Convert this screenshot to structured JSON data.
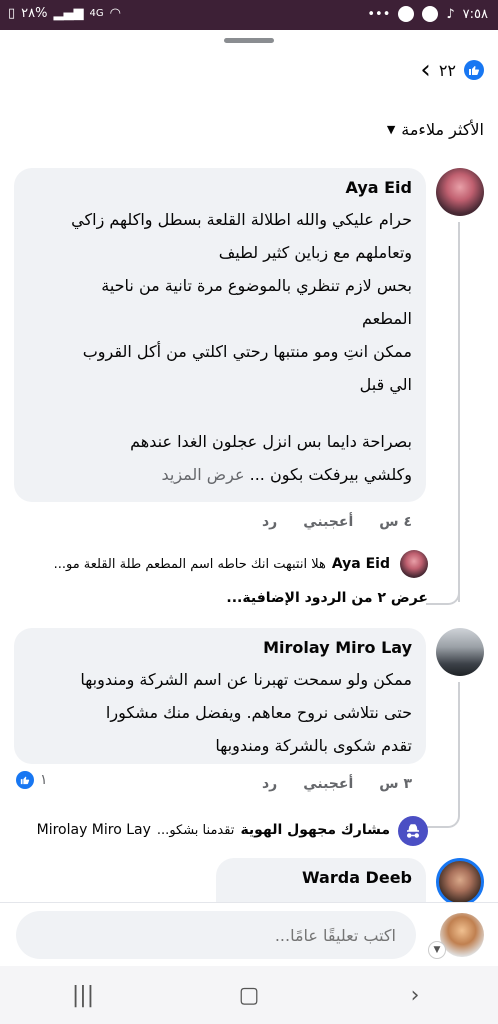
{
  "status_bar": {
    "time": "٧:٥٨",
    "battery": "٢٨%",
    "network": "4G"
  },
  "reactions": {
    "count": "٢٢"
  },
  "sort": {
    "label": "الأكثر ملاءمة"
  },
  "comments": [
    {
      "author": "Aya Eid",
      "lines": [
        "حرام عليكي والله اطلالة القلعة بسطل واكلهم زاكي",
        "وتعاملهم مع زباين كثير لطيف",
        "بحس لازم تنظري بالموضوع مرة تانية من ناحية",
        "المطعم",
        "ممكن انتِ ومو منتبها رحتي اكلتي من أكل القروب",
        "الي قبل",
        "",
        "بصراحة دايما بس انزل عجلون الغدا عندهم"
      ],
      "last_line": "وكلشي بيرفكت بكون ...",
      "see_more": "عرض المزيد",
      "time": "٤ س",
      "like_label": "أعجبني",
      "reply_label": "رد",
      "reply": {
        "author": "Aya Eid",
        "text": "هلا انتبهت انك حاطه اسم المطعم طلة القلعة مو..."
      },
      "more_replies": "عرض ٢ من الردود الإضافية..."
    },
    {
      "author": "Mirolay Miro Lay",
      "lines": [
        "ممكن ولو سمحت تهبرنا عن اسم الشركة ومندوبها",
        "حتى نتلاشى نروح معاهم. ويفضل منك مشكورا",
        "تقدم شكوى بالشركة ومندوبها"
      ],
      "time": "٣ س",
      "like_label": "أعجبني",
      "reply_label": "رد",
      "likes": "١",
      "reply": {
        "author": "مشارك مجهول الهوية",
        "text": "تقدمنا بشكو...",
        "mention": "Mirolay Miro Lay"
      }
    },
    {
      "author": "Warda Deeb"
    }
  ],
  "composer": {
    "placeholder": "اكتب تعليقًا عامًا..."
  },
  "colors": {
    "status_bar": "#3d2036",
    "bubble": "#f0f2f5",
    "like_blue": "#1877f2",
    "anon_purple": "#4b4fc4"
  }
}
